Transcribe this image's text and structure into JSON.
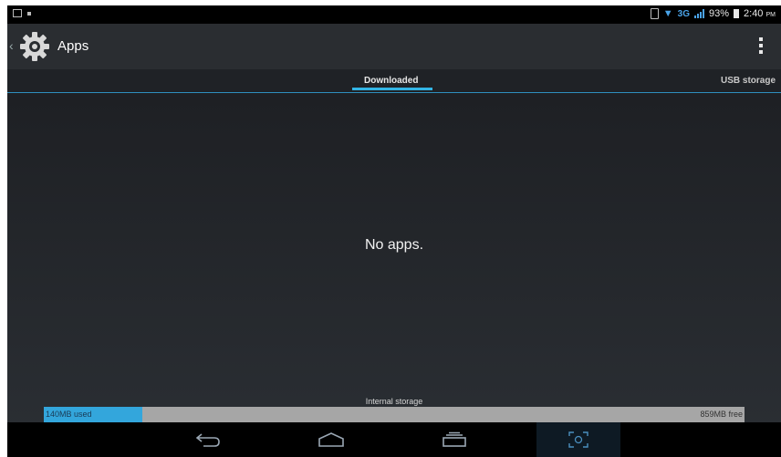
{
  "status_bar": {
    "network": "3G",
    "battery": "93%",
    "time": "2:40",
    "ampm": "PM"
  },
  "action_bar": {
    "title": "Apps"
  },
  "tabs": [
    {
      "label": "Downloaded",
      "selected": true
    },
    {
      "label": "USB storage",
      "selected": false
    }
  ],
  "content": {
    "empty_message": "No apps."
  },
  "storage": {
    "label": "Internal storage",
    "used": "140MB used",
    "free": "859MB free",
    "used_fraction": 0.14
  },
  "colors": {
    "accent": "#33b5e5",
    "storage_used": "#33a6dc",
    "storage_free": "#a6a6a6"
  },
  "icons": {
    "back": "back-arrow-icon",
    "home": "home-icon",
    "recent": "recent-apps-icon",
    "capture": "screenshot-icon"
  }
}
